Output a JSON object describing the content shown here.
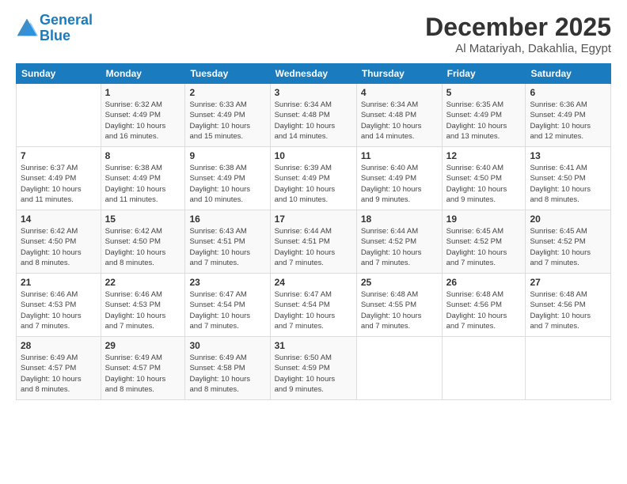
{
  "logo": {
    "line1": "General",
    "line2": "Blue"
  },
  "title": "December 2025",
  "location": "Al Matariyah, Dakahlia, Egypt",
  "weekdays": [
    "Sunday",
    "Monday",
    "Tuesday",
    "Wednesday",
    "Thursday",
    "Friday",
    "Saturday"
  ],
  "weeks": [
    [
      {
        "day": "",
        "info": ""
      },
      {
        "day": "1",
        "info": "Sunrise: 6:32 AM\nSunset: 4:49 PM\nDaylight: 10 hours\nand 16 minutes."
      },
      {
        "day": "2",
        "info": "Sunrise: 6:33 AM\nSunset: 4:49 PM\nDaylight: 10 hours\nand 15 minutes."
      },
      {
        "day": "3",
        "info": "Sunrise: 6:34 AM\nSunset: 4:48 PM\nDaylight: 10 hours\nand 14 minutes."
      },
      {
        "day": "4",
        "info": "Sunrise: 6:34 AM\nSunset: 4:48 PM\nDaylight: 10 hours\nand 14 minutes."
      },
      {
        "day": "5",
        "info": "Sunrise: 6:35 AM\nSunset: 4:49 PM\nDaylight: 10 hours\nand 13 minutes."
      },
      {
        "day": "6",
        "info": "Sunrise: 6:36 AM\nSunset: 4:49 PM\nDaylight: 10 hours\nand 12 minutes."
      }
    ],
    [
      {
        "day": "7",
        "info": "Sunrise: 6:37 AM\nSunset: 4:49 PM\nDaylight: 10 hours\nand 11 minutes."
      },
      {
        "day": "8",
        "info": "Sunrise: 6:38 AM\nSunset: 4:49 PM\nDaylight: 10 hours\nand 11 minutes."
      },
      {
        "day": "9",
        "info": "Sunrise: 6:38 AM\nSunset: 4:49 PM\nDaylight: 10 hours\nand 10 minutes."
      },
      {
        "day": "10",
        "info": "Sunrise: 6:39 AM\nSunset: 4:49 PM\nDaylight: 10 hours\nand 10 minutes."
      },
      {
        "day": "11",
        "info": "Sunrise: 6:40 AM\nSunset: 4:49 PM\nDaylight: 10 hours\nand 9 minutes."
      },
      {
        "day": "12",
        "info": "Sunrise: 6:40 AM\nSunset: 4:50 PM\nDaylight: 10 hours\nand 9 minutes."
      },
      {
        "day": "13",
        "info": "Sunrise: 6:41 AM\nSunset: 4:50 PM\nDaylight: 10 hours\nand 8 minutes."
      }
    ],
    [
      {
        "day": "14",
        "info": "Sunrise: 6:42 AM\nSunset: 4:50 PM\nDaylight: 10 hours\nand 8 minutes."
      },
      {
        "day": "15",
        "info": "Sunrise: 6:42 AM\nSunset: 4:50 PM\nDaylight: 10 hours\nand 8 minutes."
      },
      {
        "day": "16",
        "info": "Sunrise: 6:43 AM\nSunset: 4:51 PM\nDaylight: 10 hours\nand 7 minutes."
      },
      {
        "day": "17",
        "info": "Sunrise: 6:44 AM\nSunset: 4:51 PM\nDaylight: 10 hours\nand 7 minutes."
      },
      {
        "day": "18",
        "info": "Sunrise: 6:44 AM\nSunset: 4:52 PM\nDaylight: 10 hours\nand 7 minutes."
      },
      {
        "day": "19",
        "info": "Sunrise: 6:45 AM\nSunset: 4:52 PM\nDaylight: 10 hours\nand 7 minutes."
      },
      {
        "day": "20",
        "info": "Sunrise: 6:45 AM\nSunset: 4:52 PM\nDaylight: 10 hours\nand 7 minutes."
      }
    ],
    [
      {
        "day": "21",
        "info": "Sunrise: 6:46 AM\nSunset: 4:53 PM\nDaylight: 10 hours\nand 7 minutes."
      },
      {
        "day": "22",
        "info": "Sunrise: 6:46 AM\nSunset: 4:53 PM\nDaylight: 10 hours\nand 7 minutes."
      },
      {
        "day": "23",
        "info": "Sunrise: 6:47 AM\nSunset: 4:54 PM\nDaylight: 10 hours\nand 7 minutes."
      },
      {
        "day": "24",
        "info": "Sunrise: 6:47 AM\nSunset: 4:54 PM\nDaylight: 10 hours\nand 7 minutes."
      },
      {
        "day": "25",
        "info": "Sunrise: 6:48 AM\nSunset: 4:55 PM\nDaylight: 10 hours\nand 7 minutes."
      },
      {
        "day": "26",
        "info": "Sunrise: 6:48 AM\nSunset: 4:56 PM\nDaylight: 10 hours\nand 7 minutes."
      },
      {
        "day": "27",
        "info": "Sunrise: 6:48 AM\nSunset: 4:56 PM\nDaylight: 10 hours\nand 7 minutes."
      }
    ],
    [
      {
        "day": "28",
        "info": "Sunrise: 6:49 AM\nSunset: 4:57 PM\nDaylight: 10 hours\nand 8 minutes."
      },
      {
        "day": "29",
        "info": "Sunrise: 6:49 AM\nSunset: 4:57 PM\nDaylight: 10 hours\nand 8 minutes."
      },
      {
        "day": "30",
        "info": "Sunrise: 6:49 AM\nSunset: 4:58 PM\nDaylight: 10 hours\nand 8 minutes."
      },
      {
        "day": "31",
        "info": "Sunrise: 6:50 AM\nSunset: 4:59 PM\nDaylight: 10 hours\nand 9 minutes."
      },
      {
        "day": "",
        "info": ""
      },
      {
        "day": "",
        "info": ""
      },
      {
        "day": "",
        "info": ""
      }
    ]
  ]
}
